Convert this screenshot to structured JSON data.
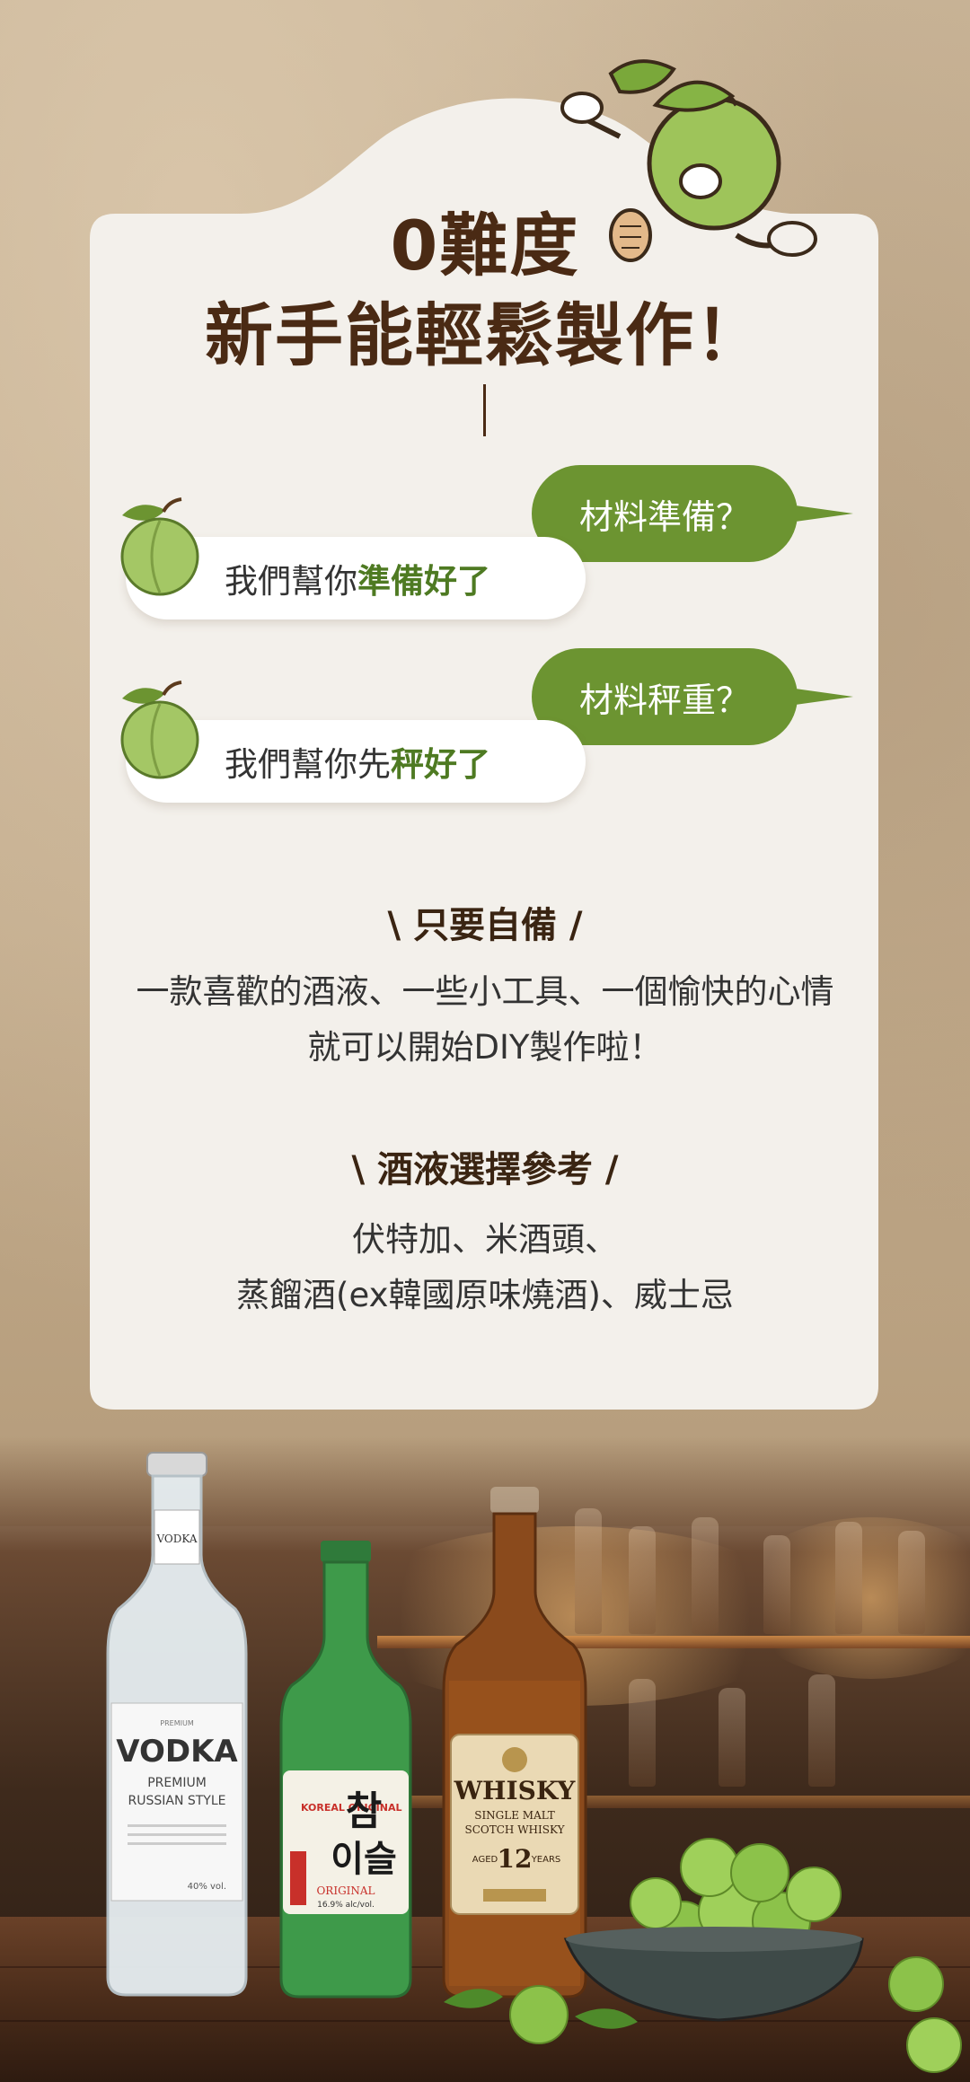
{
  "heading": {
    "line1": "0難度",
    "line2": "新手能輕鬆製作！"
  },
  "faq": [
    {
      "question": "材料準備？",
      "answer_prefix": "我們幫你",
      "answer_highlight": "準備好了"
    },
    {
      "question": "材料秤重？",
      "answer_prefix": "我們幫你先",
      "answer_highlight": "秤好了"
    }
  ],
  "prepare": {
    "title": "\\ 只要自備 /",
    "line1": "一款喜歡的酒液、一些小工具、一個愉快的心情",
    "line2": "就可以開始DIY製作啦！"
  },
  "liquor": {
    "title": "\\ 酒液選擇參考 /",
    "line1": "伏特加、米酒頭、",
    "line2": "蒸餾酒(ex韓國原味燒酒)、威士忌"
  },
  "bottles": {
    "vodka": {
      "neck": "VODKA",
      "small_top": "PREMIUM",
      "brand": "VODKA",
      "sub1": "PREMIUM",
      "sub2": "RUSSIAN STYLE",
      "vol": "40% vol."
    },
    "soju": {
      "hangul1": "참",
      "hangul2": "이슬",
      "en": "KOREAL ORIGINAL",
      "label": "ORIGINAL",
      "abv": "16.9% alc/vol."
    },
    "whisky": {
      "brand": "WHISKY",
      "sub1": "SINGLE MALT",
      "sub2": "SCOTCH WHISKY",
      "aged": "AGED",
      "years": "12",
      "years_label": "YEARS"
    }
  },
  "colors": {
    "brand_green": "#6c9431",
    "title_brown": "#4a2a14",
    "card_bg": "#f3f0eb"
  }
}
